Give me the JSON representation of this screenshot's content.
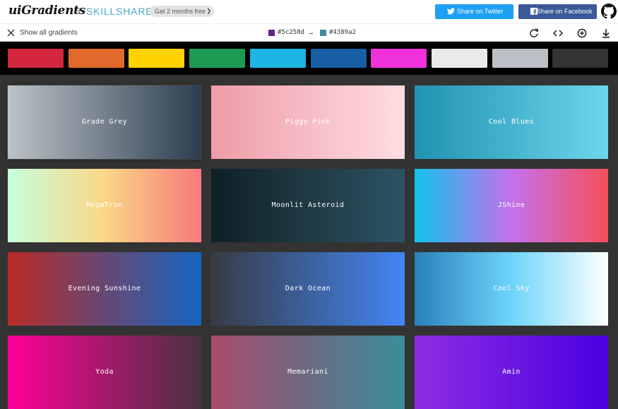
{
  "header": {
    "logo": "uiGradients",
    "plus": "+",
    "partner": "SKILLSHARE",
    "promo": "Get 2 months free",
    "twitter_label": "Share on Twitter",
    "facebook_label": "Share on Facebook",
    "colors": {
      "twitter": "#1da1f2",
      "facebook": "#3b5998"
    }
  },
  "toolbar": {
    "show_all": "Show all gradients",
    "color_from": "#5c258d",
    "color_to": "#4389a2",
    "arrow": "→",
    "icons": [
      "rotate-icon",
      "code-icon",
      "add-icon",
      "download-icon"
    ]
  },
  "filters": [
    {
      "color": "#d3273e"
    },
    {
      "color": "#e0692b"
    },
    {
      "color": "#ffd200"
    },
    {
      "color": "#1d9b54"
    },
    {
      "color": "#1eb5e4"
    },
    {
      "color": "#175ea4"
    },
    {
      "color": "#ef32d9"
    },
    {
      "color": "#eaeaea"
    },
    {
      "color": "#bdbfc7"
    },
    {
      "color": "#333333"
    }
  ],
  "gradients": [
    {
      "name": "Grade Grey",
      "from": "#bdc3c7",
      "to": "#2c3e50"
    },
    {
      "name": "Piggy Pink",
      "from": "#ee9ca7",
      "to": "#ffdde1"
    },
    {
      "name": "Cool Blues",
      "from": "#2193b0",
      "to": "#6dd5ed"
    },
    {
      "name": "MegaTron",
      "from": "#c6ffdd",
      "via": "#fbd786",
      "to": "#f7797d"
    },
    {
      "name": "Moonlit Asteroid",
      "from": "#0f2027",
      "via": "#203a43",
      "to": "#2c5364"
    },
    {
      "name": "JShine",
      "from": "#12c2e9",
      "via": "#c471ed",
      "to": "#f64f59"
    },
    {
      "name": "Evening Sunshine",
      "from": "#b92b27",
      "to": "#1565c0"
    },
    {
      "name": "Dark Ocean",
      "from": "#373b44",
      "to": "#4286f4"
    },
    {
      "name": "Cool Sky",
      "from": "#2980b9",
      "via": "#6dd5fa",
      "to": "#ffffff"
    },
    {
      "name": "Yoda",
      "from": "#ff0099",
      "to": "#493240"
    },
    {
      "name": "Memariani",
      "from": "#aa4b6b",
      "via": "#6b6b83",
      "to": "#3b8d99"
    },
    {
      "name": "Amin",
      "from": "#8e2de2",
      "to": "#4a00e0"
    }
  ]
}
